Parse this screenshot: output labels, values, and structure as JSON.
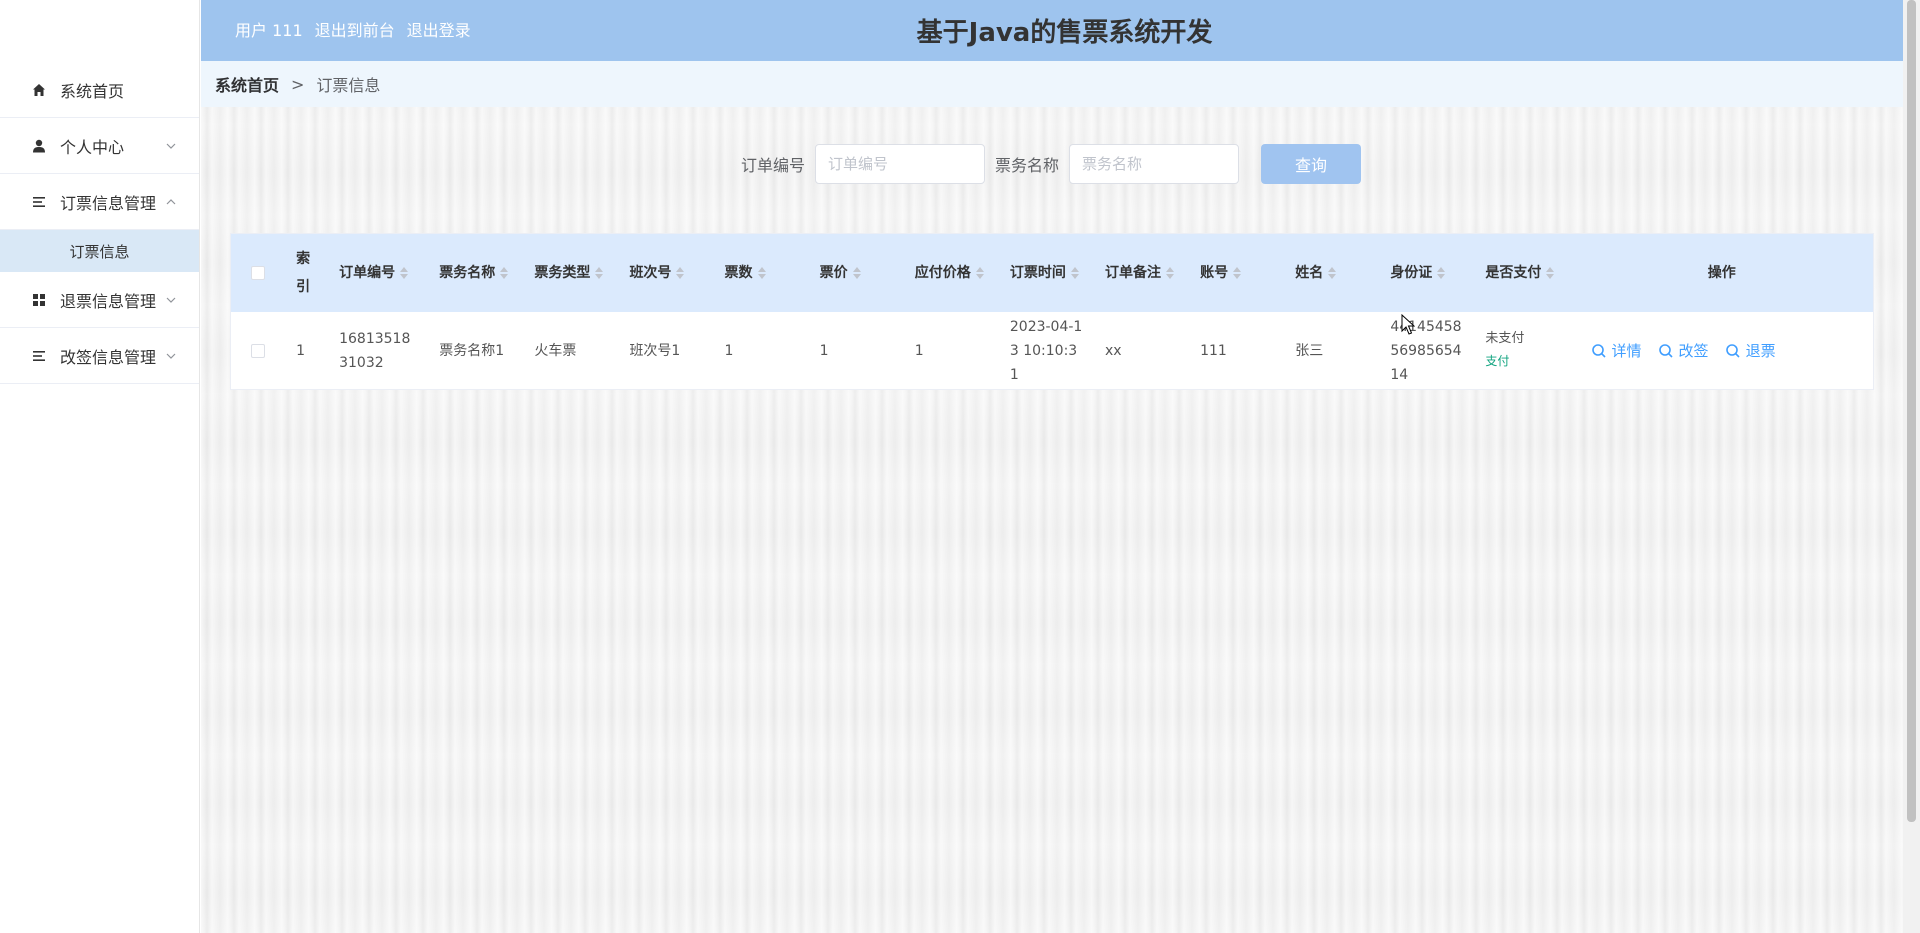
{
  "header": {
    "user_label": "用户 111",
    "to_front": "退出到前台",
    "logout": "退出登录",
    "title": "基于Java的售票系统开发"
  },
  "sidebar": {
    "items": [
      {
        "label": "系统首页",
        "icon": "home-icon"
      },
      {
        "label": "个人中心",
        "icon": "user-icon"
      },
      {
        "label": "订票信息管理",
        "icon": "list-icon",
        "expanded": true,
        "sub": [
          "订票信息"
        ]
      },
      {
        "label": "退票信息管理",
        "icon": "grid-icon"
      },
      {
        "label": "改签信息管理",
        "icon": "list-icon"
      }
    ]
  },
  "breadcrumb": {
    "home": "系统首页",
    "separator": ">",
    "current": "订票信息"
  },
  "search": {
    "order_label": "订单编号",
    "order_placeholder": "订单编号",
    "ticket_label": "票务名称",
    "ticket_placeholder": "票务名称",
    "query_label": "查询"
  },
  "table": {
    "headers": {
      "index": "索引",
      "order_no": "订单编号",
      "ticket_name": "票务名称",
      "ticket_type": "票务类型",
      "shift_no": "班次号",
      "count": "票数",
      "price": "票价",
      "payable": "应付价格",
      "order_time": "订票时间",
      "remark": "订单备注",
      "account": "账号",
      "name": "姓名",
      "id_card": "身份证",
      "paid": "是否支付",
      "actions": "操作"
    },
    "rows": [
      {
        "index": "1",
        "order_no": "1681351831032",
        "ticket_name": "票务名称1",
        "ticket_type": "火车票",
        "shift_no": "班次号1",
        "count": "1",
        "price": "1",
        "payable": "1",
        "order_time": "2023-04-13 10:10:31",
        "remark": "xx",
        "account": "111",
        "name": "张三",
        "id_card": "441454585698565414",
        "paid_status": "未支付",
        "pay_link": "支付",
        "op_detail": "详情",
        "op_change": "改签",
        "op_refund": "退票"
      }
    ]
  },
  "colors": {
    "topbar": "#9ec4ee",
    "breadcrumb_bg": "#eef6fd",
    "table_header": "#dbeafd",
    "link": "#409eff",
    "pay_link": "#10a37f",
    "query_button": "#a0c4f0"
  }
}
